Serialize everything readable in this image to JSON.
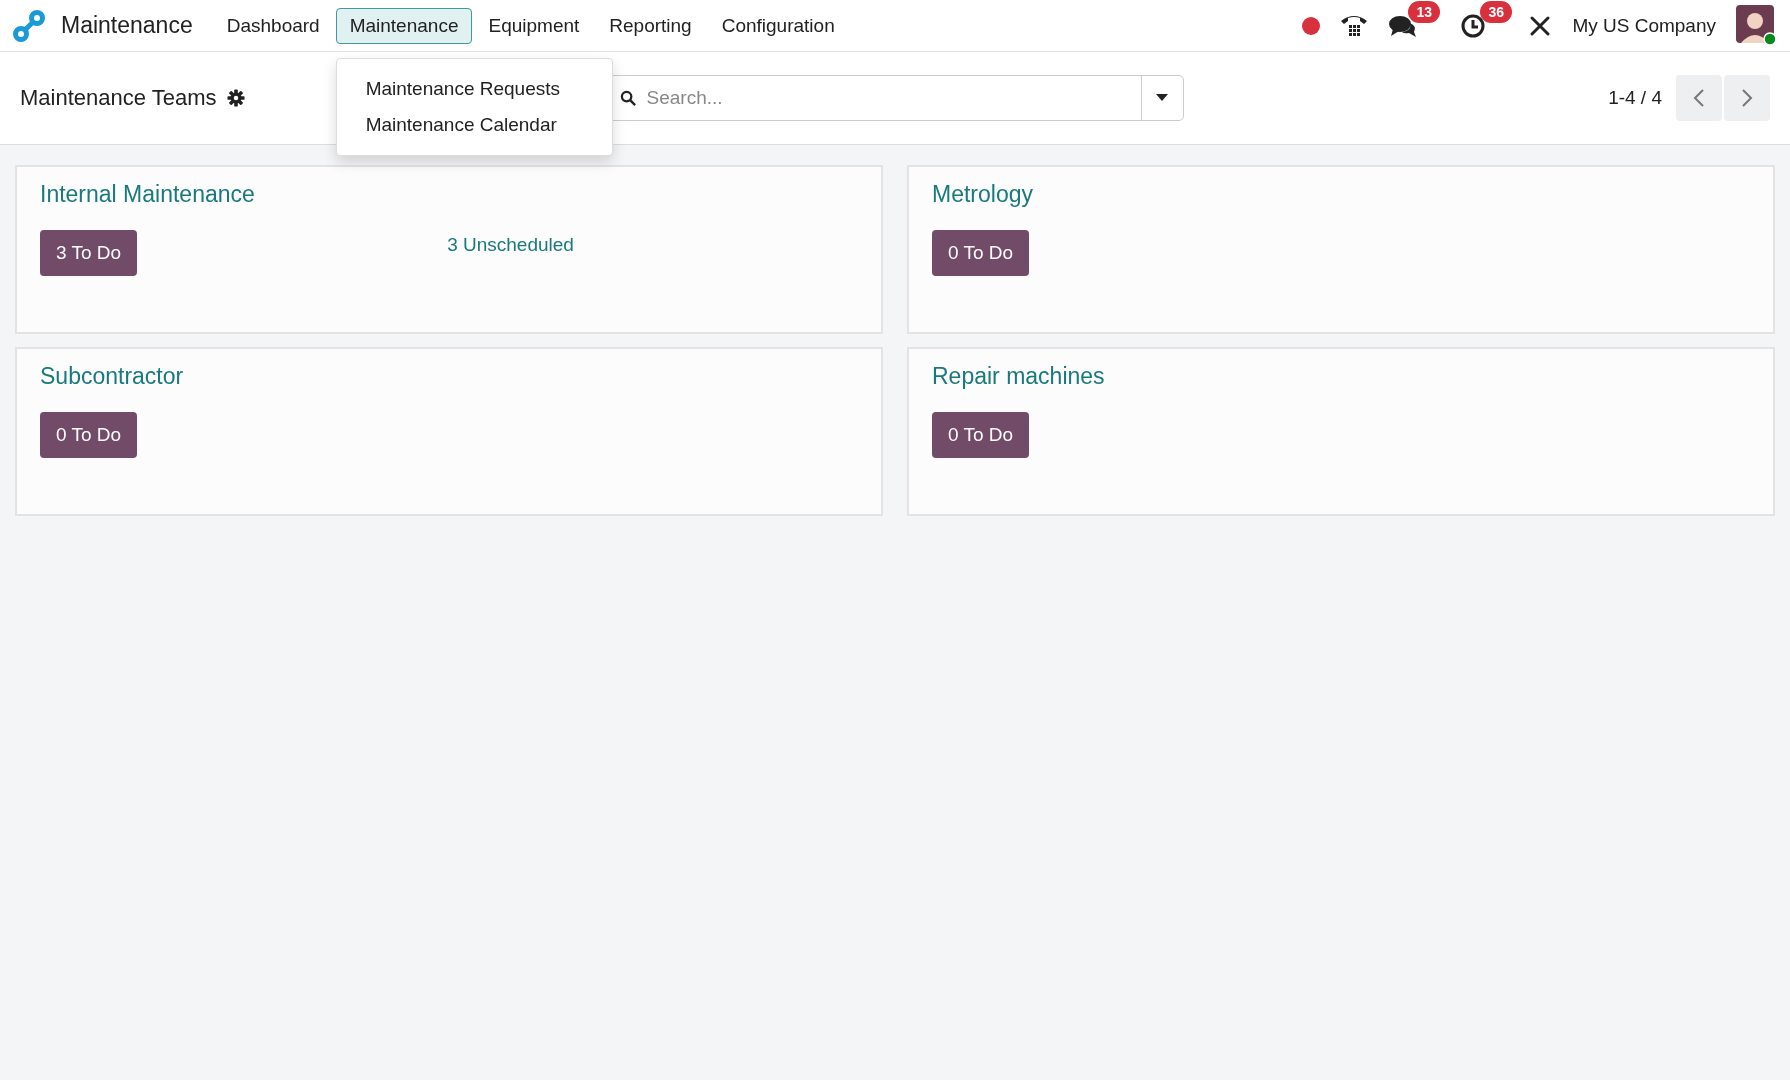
{
  "app": {
    "name": "Maintenance"
  },
  "menu": [
    {
      "label": "Dashboard",
      "selected": false
    },
    {
      "label": "Maintenance",
      "selected": true,
      "dropdown": [
        "Maintenance Requests",
        "Maintenance Calendar"
      ]
    },
    {
      "label": "Equipment",
      "selected": false
    },
    {
      "label": "Reporting",
      "selected": false
    },
    {
      "label": "Configuration",
      "selected": false
    }
  ],
  "systray": {
    "chat_badge": "13",
    "activity_badge": "36",
    "company": "My US Company"
  },
  "control_panel": {
    "title": "Maintenance Teams",
    "search": {
      "placeholder": "Search..."
    },
    "pager": "1-4 / 4"
  },
  "teams": [
    {
      "name": "Internal Maintenance",
      "todo": "3 To Do",
      "unscheduled": "3 Unscheduled"
    },
    {
      "name": "Metrology",
      "todo": "0 To Do"
    },
    {
      "name": "Subcontractor",
      "todo": "0 To Do"
    },
    {
      "name": "Repair machines",
      "todo": "0 To Do"
    }
  ]
}
